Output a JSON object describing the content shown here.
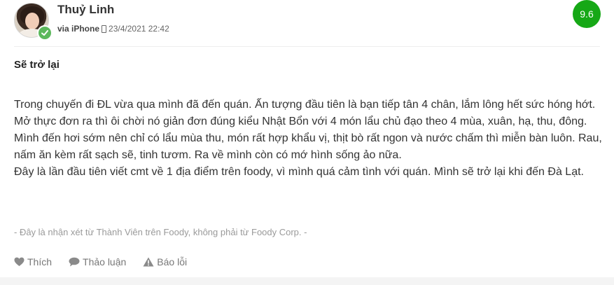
{
  "user": {
    "name": "Thuỷ Linh",
    "device": "via iPhone",
    "timestamp": "23/4/2021 22:42"
  },
  "score": "9.6",
  "colors": {
    "score_bg": "#16a816",
    "verified_badge": "#5cb85c"
  },
  "review": {
    "title": "Sẽ trở lại",
    "paragraphs": [
      "Trong chuyến đi ĐL vừa qua mình đã đến quán. Ấn tượng đầu tiên là bạn tiếp tân 4 chân, lắm lông hết sức hóng hớt. Mở thực đơn ra thì ôi chời nó giản đơn đúng kiểu Nhật Bổn với 4 món lẩu chủ đạo theo 4 mùa, xuân, hạ, thu, đông. Mình đến hơi sớm nên chỉ có lẩu mùa thu, món rất hợp khẩu vị, thịt bò rất ngon và nước chấm thì miễn bàn luôn. Rau, nấm ăn kèm rất sạch sẽ, tinh tươm. Ra về mình còn có mớ hình sống ảo nữa.",
      "Đây là lần đầu tiên viết cmt về 1 địa điểm trên foody, vì mình quá cảm tình với quán. Mình sẽ trở lại khi đến Đà Lạt."
    ],
    "disclaimer": "- Đây là nhận xét từ Thành Viên trên Foody, không phải từ Foody Corp. -"
  },
  "actions": {
    "like": {
      "label": "Thích",
      "icon": "heart-icon"
    },
    "discuss": {
      "label": "Thảo luận",
      "icon": "comment-icon"
    },
    "report": {
      "label": "Báo lỗi",
      "icon": "warning-icon"
    }
  }
}
